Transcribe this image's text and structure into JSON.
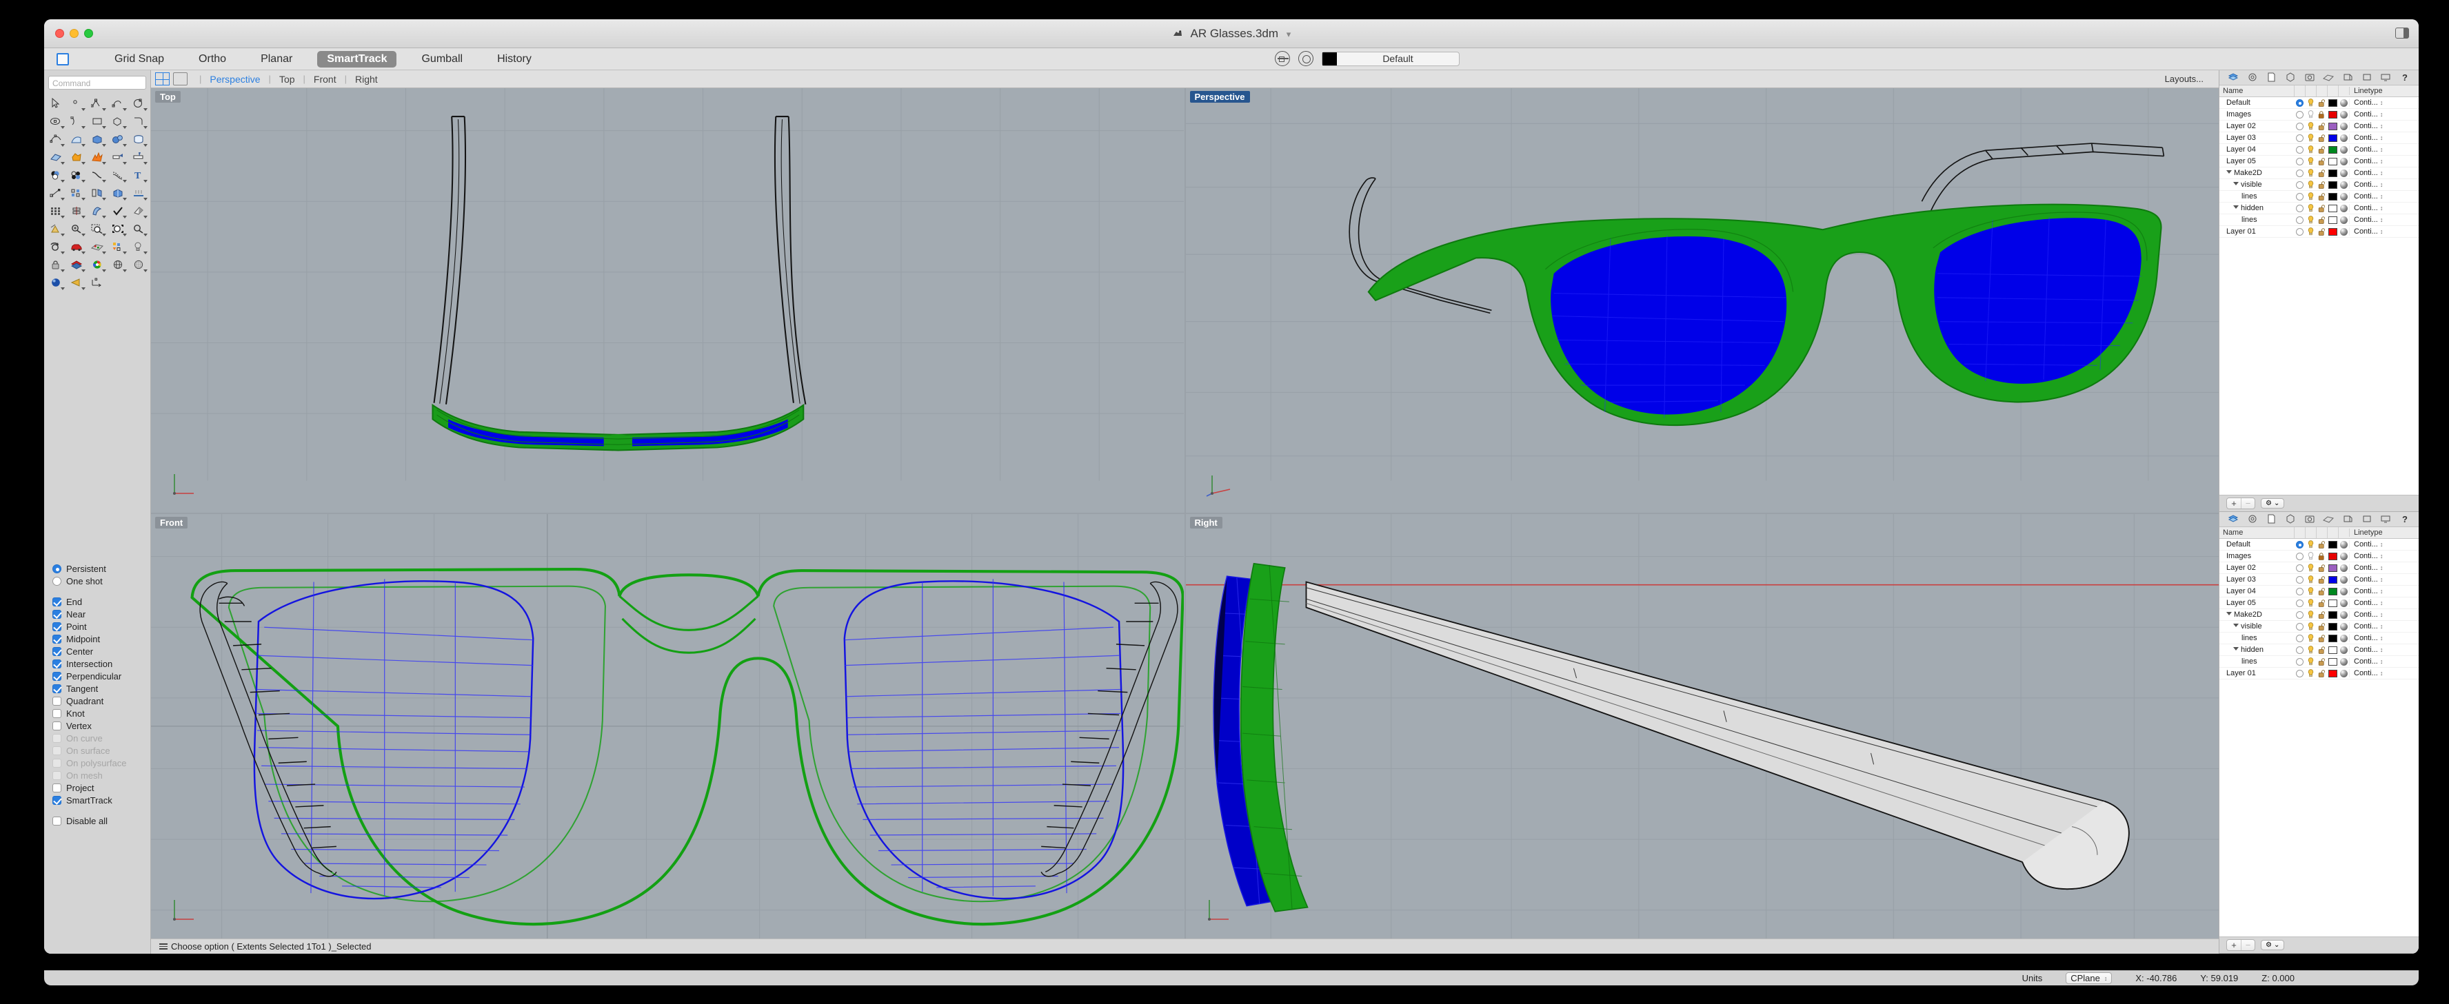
{
  "window": {
    "title": "AR Glasses.3dm",
    "traffic_lights": [
      "close",
      "minimize",
      "zoom"
    ]
  },
  "menubar": {
    "items": [
      {
        "label": "Grid Snap",
        "active": false
      },
      {
        "label": "Ortho",
        "active": false
      },
      {
        "label": "Planar",
        "active": false
      },
      {
        "label": "SmartTrack",
        "active": true
      },
      {
        "label": "Gumball",
        "active": false
      },
      {
        "label": "History",
        "active": false
      }
    ],
    "layer_selector": {
      "color": "#000000",
      "name": "Default"
    }
  },
  "command_palette": {
    "placeholder": "Command"
  },
  "viewport_tabs": {
    "tabs": [
      {
        "label": "Perspective",
        "active": true
      },
      {
        "label": "Top",
        "active": false
      },
      {
        "label": "Front",
        "active": false
      },
      {
        "label": "Right",
        "active": false
      }
    ],
    "layouts_button": "Layouts..."
  },
  "viewports": [
    {
      "label": "Top",
      "active": false
    },
    {
      "label": "Perspective",
      "active": true
    },
    {
      "label": "Front",
      "active": false
    },
    {
      "label": "Right",
      "active": false
    }
  ],
  "osnap": {
    "mode_options": [
      {
        "label": "Persistent",
        "selected": true
      },
      {
        "label": "One shot",
        "selected": false
      }
    ],
    "snaps": [
      {
        "label": "End",
        "checked": true,
        "disabled": false
      },
      {
        "label": "Near",
        "checked": true,
        "disabled": false
      },
      {
        "label": "Point",
        "checked": true,
        "disabled": false
      },
      {
        "label": "Midpoint",
        "checked": true,
        "disabled": false
      },
      {
        "label": "Center",
        "checked": true,
        "disabled": false
      },
      {
        "label": "Intersection",
        "checked": true,
        "disabled": false
      },
      {
        "label": "Perpendicular",
        "checked": true,
        "disabled": false
      },
      {
        "label": "Tangent",
        "checked": true,
        "disabled": false
      },
      {
        "label": "Quadrant",
        "checked": false,
        "disabled": false
      },
      {
        "label": "Knot",
        "checked": false,
        "disabled": false
      },
      {
        "label": "Vertex",
        "checked": false,
        "disabled": false
      },
      {
        "label": "On curve",
        "checked": false,
        "disabled": true
      },
      {
        "label": "On surface",
        "checked": false,
        "disabled": true
      },
      {
        "label": "On polysurface",
        "checked": false,
        "disabled": true
      },
      {
        "label": "On mesh",
        "checked": false,
        "disabled": true
      },
      {
        "label": "Project",
        "checked": false,
        "disabled": false
      },
      {
        "label": "SmartTrack",
        "checked": true,
        "disabled": false
      }
    ],
    "disable_all": {
      "label": "Disable all",
      "checked": false
    }
  },
  "layer_panel": {
    "columns": {
      "name": "Name",
      "linetype": "Linetype"
    },
    "linetype_value": "Conti...",
    "rows": [
      {
        "name": "Default",
        "depth": 0,
        "expander": false,
        "current": true,
        "on": true,
        "locked": false,
        "color": "#000000"
      },
      {
        "name": "Images",
        "depth": 0,
        "expander": false,
        "current": false,
        "on": false,
        "locked": true,
        "color": "#e60000"
      },
      {
        "name": "Layer 02",
        "depth": 0,
        "expander": false,
        "current": false,
        "on": true,
        "locked": false,
        "color": "#9b5fc0"
      },
      {
        "name": "Layer 03",
        "depth": 0,
        "expander": false,
        "current": false,
        "on": true,
        "locked": false,
        "color": "#0000e8"
      },
      {
        "name": "Layer 04",
        "depth": 0,
        "expander": false,
        "current": false,
        "on": true,
        "locked": false,
        "color": "#00881f"
      },
      {
        "name": "Layer 05",
        "depth": 0,
        "expander": false,
        "current": false,
        "on": true,
        "locked": false,
        "color": "#ffffff"
      },
      {
        "name": "Make2D",
        "depth": 0,
        "expander": true,
        "current": false,
        "on": true,
        "locked": false,
        "color": "#000000"
      },
      {
        "name": "visible",
        "depth": 1,
        "expander": true,
        "current": false,
        "on": true,
        "locked": false,
        "color": "#000000"
      },
      {
        "name": "lines",
        "depth": 2,
        "expander": false,
        "current": false,
        "on": true,
        "locked": false,
        "color": "#000000"
      },
      {
        "name": "hidden",
        "depth": 1,
        "expander": true,
        "current": false,
        "on": true,
        "locked": false,
        "color": "#ffffff"
      },
      {
        "name": "lines",
        "depth": 2,
        "expander": false,
        "current": false,
        "on": true,
        "locked": false,
        "color": "#ffffff"
      },
      {
        "name": "Layer 01",
        "depth": 0,
        "expander": false,
        "current": false,
        "on": true,
        "locked": false,
        "color": "#ff0000"
      }
    ],
    "footer": {
      "add": "+",
      "remove": "−",
      "gear": "⚙",
      "chevron": "⌄"
    }
  },
  "command_line": {
    "text": "Choose option ( Extents Selected 1To1 )_Selected"
  },
  "status_bar": {
    "units_label": "Units",
    "cplane": "CPlane",
    "x": "X: -40.786",
    "y": "Y: 59.019",
    "z": "Z: 0.000"
  },
  "model": {
    "name": "AR Glasses",
    "frame_color": "#19a019",
    "lens_color": "#0000e8",
    "wireframe_color": "#111111",
    "temple_shade": "#dcdcdc",
    "viewport_background": "#a3abb2",
    "grid_line_color": "#9aa2a9",
    "axis_red": "#c84040",
    "axis_green": "#3c8c3c"
  }
}
